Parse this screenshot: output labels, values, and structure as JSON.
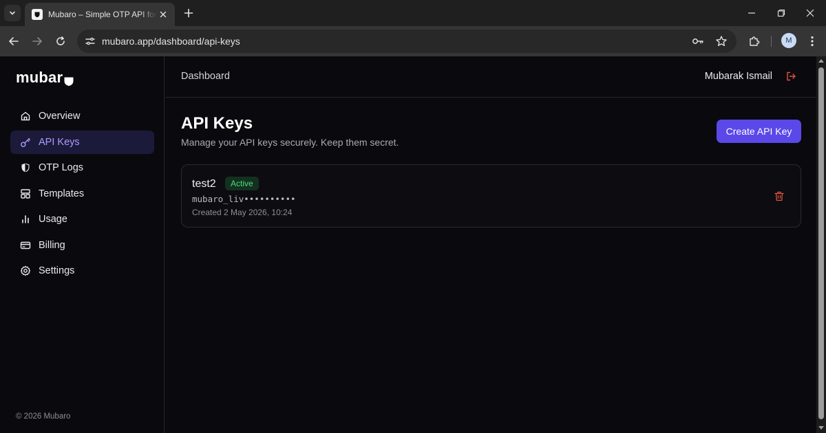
{
  "browser": {
    "tab_title": "Mubaro – Simple OTP API for Developers",
    "url": "mubaro.app/dashboard/api-keys",
    "profile_initial": "M"
  },
  "app": {
    "logo_text": "mubar",
    "nav": [
      {
        "label": "Overview",
        "icon": "home-icon",
        "active": false
      },
      {
        "label": "API Keys",
        "icon": "key-icon",
        "active": true
      },
      {
        "label": "OTP Logs",
        "icon": "shield-icon",
        "active": false
      },
      {
        "label": "Templates",
        "icon": "layout-icon",
        "active": false
      },
      {
        "label": "Usage",
        "icon": "bar-chart-icon",
        "active": false
      },
      {
        "label": "Billing",
        "icon": "credit-card-icon",
        "active": false
      },
      {
        "label": "Settings",
        "icon": "gear-icon",
        "active": false
      }
    ],
    "copyright": "© 2026 Mubaro"
  },
  "header": {
    "breadcrumb": "Dashboard",
    "user_name": "Mubarak Ismail"
  },
  "page": {
    "title": "API Keys",
    "subtitle": "Manage your API keys securely. Keep them secret.",
    "create_button": "Create API Key"
  },
  "keys": [
    {
      "name": "test2",
      "status": "Active",
      "masked_key": "mubaro_liv••••••••••",
      "created": "Created 2 May 2026, 10:24"
    }
  ],
  "colors": {
    "accent": "#5b48e8",
    "active_nav_text": "#a99cff",
    "status_active": "#4ade80",
    "danger": "#e5533d"
  }
}
